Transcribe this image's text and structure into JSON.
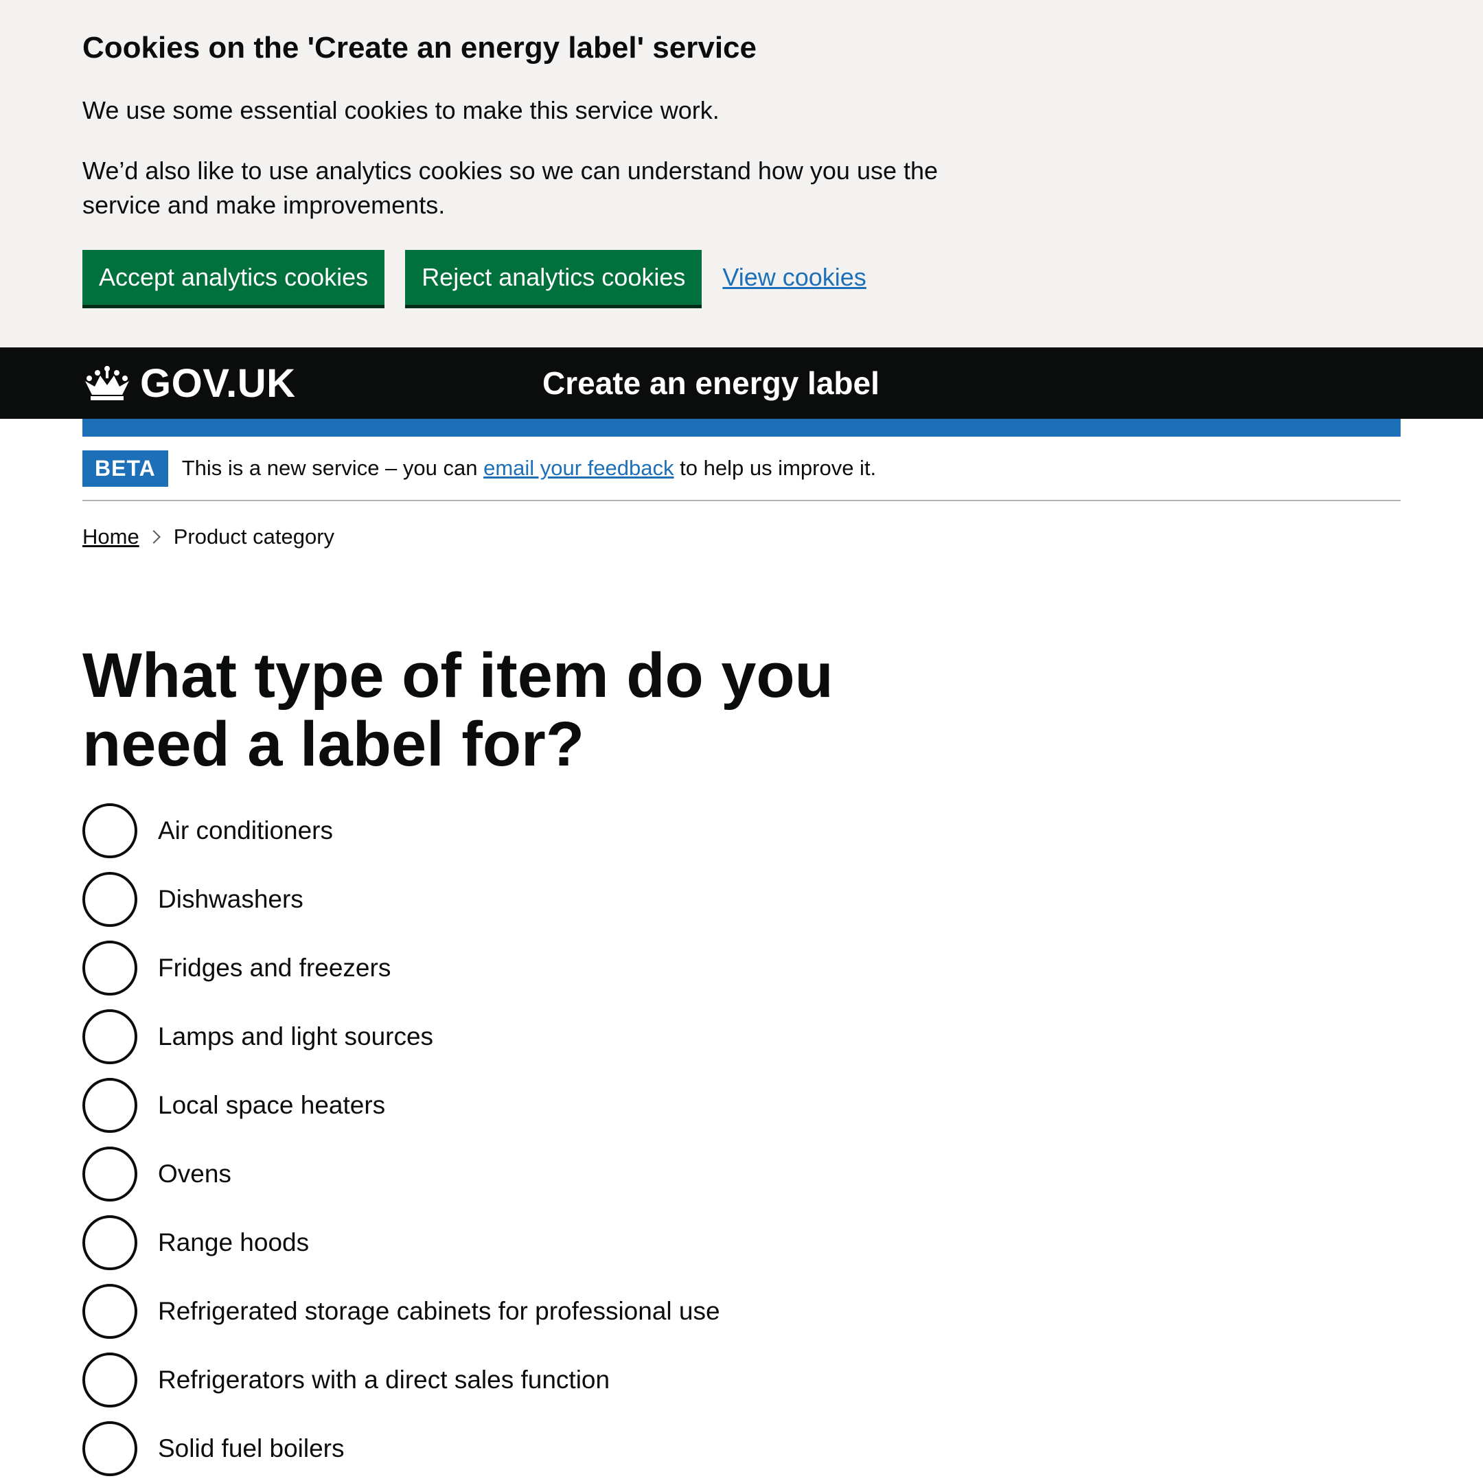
{
  "cookie_banner": {
    "heading": "Cookies on the 'Create an energy label' service",
    "paragraph_1": "We use some essential cookies to make this service work.",
    "paragraph_2": "We’d also like to use analytics cookies so we can understand how you use the service and make improvements.",
    "accept_label": "Accept analytics cookies",
    "reject_label": "Reject analytics cookies",
    "view_label": "View cookies"
  },
  "header": {
    "logo_text": "GOV.UK",
    "service_name": "Create an energy label"
  },
  "phase_banner": {
    "tag": "BETA",
    "text_before": "This is a new service – you can ",
    "link_text": "email your feedback",
    "text_after": " to help us improve it."
  },
  "breadcrumb": {
    "home": "Home",
    "current": "Product category"
  },
  "page": {
    "heading": "What type of item do you need a label for?"
  },
  "options": [
    "Air conditioners",
    "Dishwashers",
    "Fridges and freezers",
    "Lamps and light sources",
    "Local space heaters",
    "Ovens",
    "Range hoods",
    "Refrigerated storage cabinets for professional use",
    "Refrigerators with a direct sales function",
    "Solid fuel boilers"
  ],
  "colors": {
    "brand_green": "#00703c",
    "link_blue": "#1d70b8",
    "header_black": "#0b0c0c",
    "banner_grey": "#f3f2f1"
  }
}
